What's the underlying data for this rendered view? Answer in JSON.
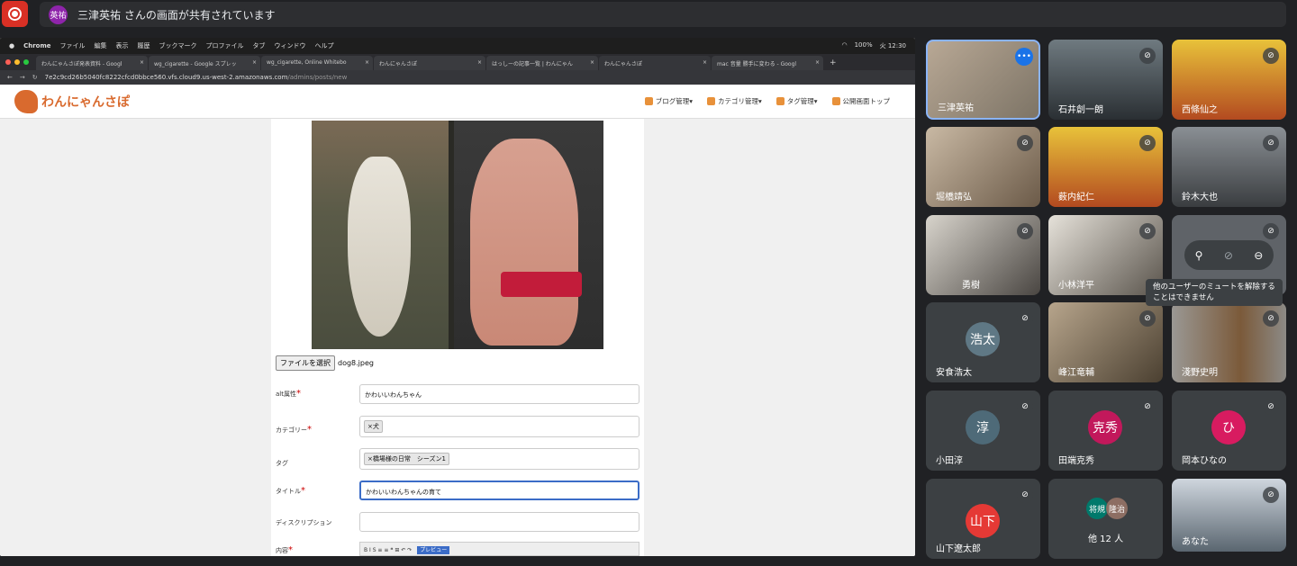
{
  "banner": {
    "presenter_initials": "英祐",
    "share_message": "三津英祐 さんの画面が共有されています"
  },
  "mac_menu": {
    "items": [
      "Chrome",
      "ファイル",
      "編集",
      "表示",
      "履歴",
      "ブックマーク",
      "プロファイル",
      "タブ",
      "ウィンドウ",
      "ヘルプ"
    ],
    "battery": "100%",
    "clock": "火 12:30"
  },
  "browser": {
    "tabs": [
      {
        "label": "わんにゃんさぽ発表資料 - Googl"
      },
      {
        "label": "wg_cigarette - Google スプレッ"
      },
      {
        "label": "wg_cigarette, Online Whitebo"
      },
      {
        "label": "わんにゃんさぽ"
      },
      {
        "label": "はっしーの記事一覧 | わんにゃん"
      },
      {
        "label": "わんにゃんさぽ"
      },
      {
        "label": "mac 音量 勝手に変わる - Googl"
      }
    ],
    "url_host": "7e2c9cd26b5040fc8222cfcd0bbce560.vfs.cloud9.us-west-2.amazonaws.com",
    "url_path": "/admins/posts/new"
  },
  "site": {
    "logo_text": "わんにゃんさぽ",
    "nav": [
      "ブログ管理▾",
      "カテゴリ管理▾",
      "タグ管理▾",
      "公開画面トップ"
    ]
  },
  "form": {
    "file_button": "ファイルを選択",
    "file_name": "dog8.jpeg",
    "alt_label": "alt属性",
    "alt_value": "かわいいわんちゃん",
    "category_label": "カテゴリー",
    "category_chip": "×犬",
    "tag_label": "タグ",
    "tag_chip": "×橋場様の日常　シーズン1",
    "title_label": "タイトル",
    "title_value": "かわいいわんちゃんの育て",
    "description_label": "ディスクリプション",
    "content_label": "内容",
    "preview_label": "プレビュー"
  },
  "participants": [
    {
      "name": "三津英祐"
    },
    {
      "name": "石井創一朗"
    },
    {
      "name": "西條仙之"
    },
    {
      "name": "堀橋靖弘"
    },
    {
      "name": "薮内紀仁"
    },
    {
      "name": "鈴木大也"
    },
    {
      "name": "勇樹"
    },
    {
      "name": "小林洋平"
    },
    {
      "name": ""
    },
    {
      "name": "安食浩太",
      "avatar": "浩太"
    },
    {
      "name": "峰江竜輔"
    },
    {
      "name": "淺野史明"
    },
    {
      "name": "小田淳",
      "avatar": "淳"
    },
    {
      "name": "田端克秀",
      "avatar": "克秀"
    },
    {
      "name": "岡本ひなの",
      "avatar": "ひ"
    },
    {
      "name": "山下遼太郎",
      "avatar": "山下"
    },
    {
      "name": "他 12 人",
      "avatars": [
        "将規",
        "隆治"
      ]
    },
    {
      "name": "あなた"
    }
  ],
  "tooltip": "他のユーザーのミュートを解除することはできません"
}
